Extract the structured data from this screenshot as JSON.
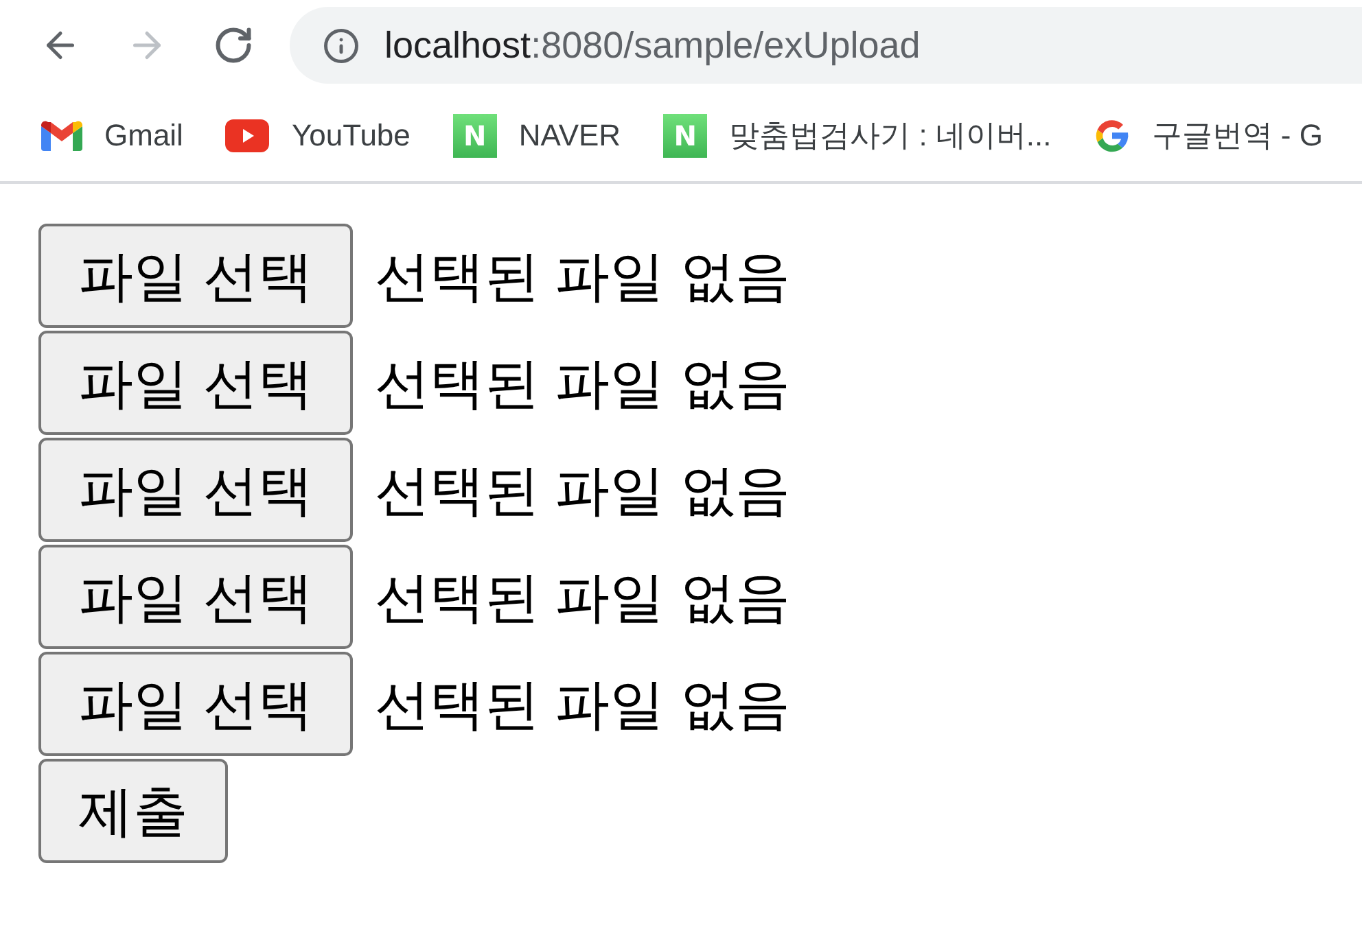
{
  "toolbar": {
    "back": {
      "disabled": false
    },
    "forward": {
      "disabled": true
    },
    "address": {
      "host": "localhost",
      "path": ":8080/sample/exUpload"
    }
  },
  "bookmarks": [
    {
      "kind": "gmail",
      "label": "Gmail"
    },
    {
      "kind": "youtube",
      "label": "YouTube"
    },
    {
      "kind": "naver",
      "icon_letter": "N",
      "label": "NAVER"
    },
    {
      "kind": "naver",
      "icon_letter": "N",
      "label": "맞춤법검사기 : 네이버..."
    },
    {
      "kind": "google",
      "label": "구글번역 - G"
    }
  ],
  "form": {
    "file_inputs": [
      {
        "button": "파일 선택",
        "status": "선택된 파일 없음"
      },
      {
        "button": "파일 선택",
        "status": "선택된 파일 없음"
      },
      {
        "button": "파일 선택",
        "status": "선택된 파일 없음"
      },
      {
        "button": "파일 선택",
        "status": "선택된 파일 없음"
      },
      {
        "button": "파일 선택",
        "status": "선택된 파일 없음"
      }
    ],
    "submit": "제출"
  }
}
